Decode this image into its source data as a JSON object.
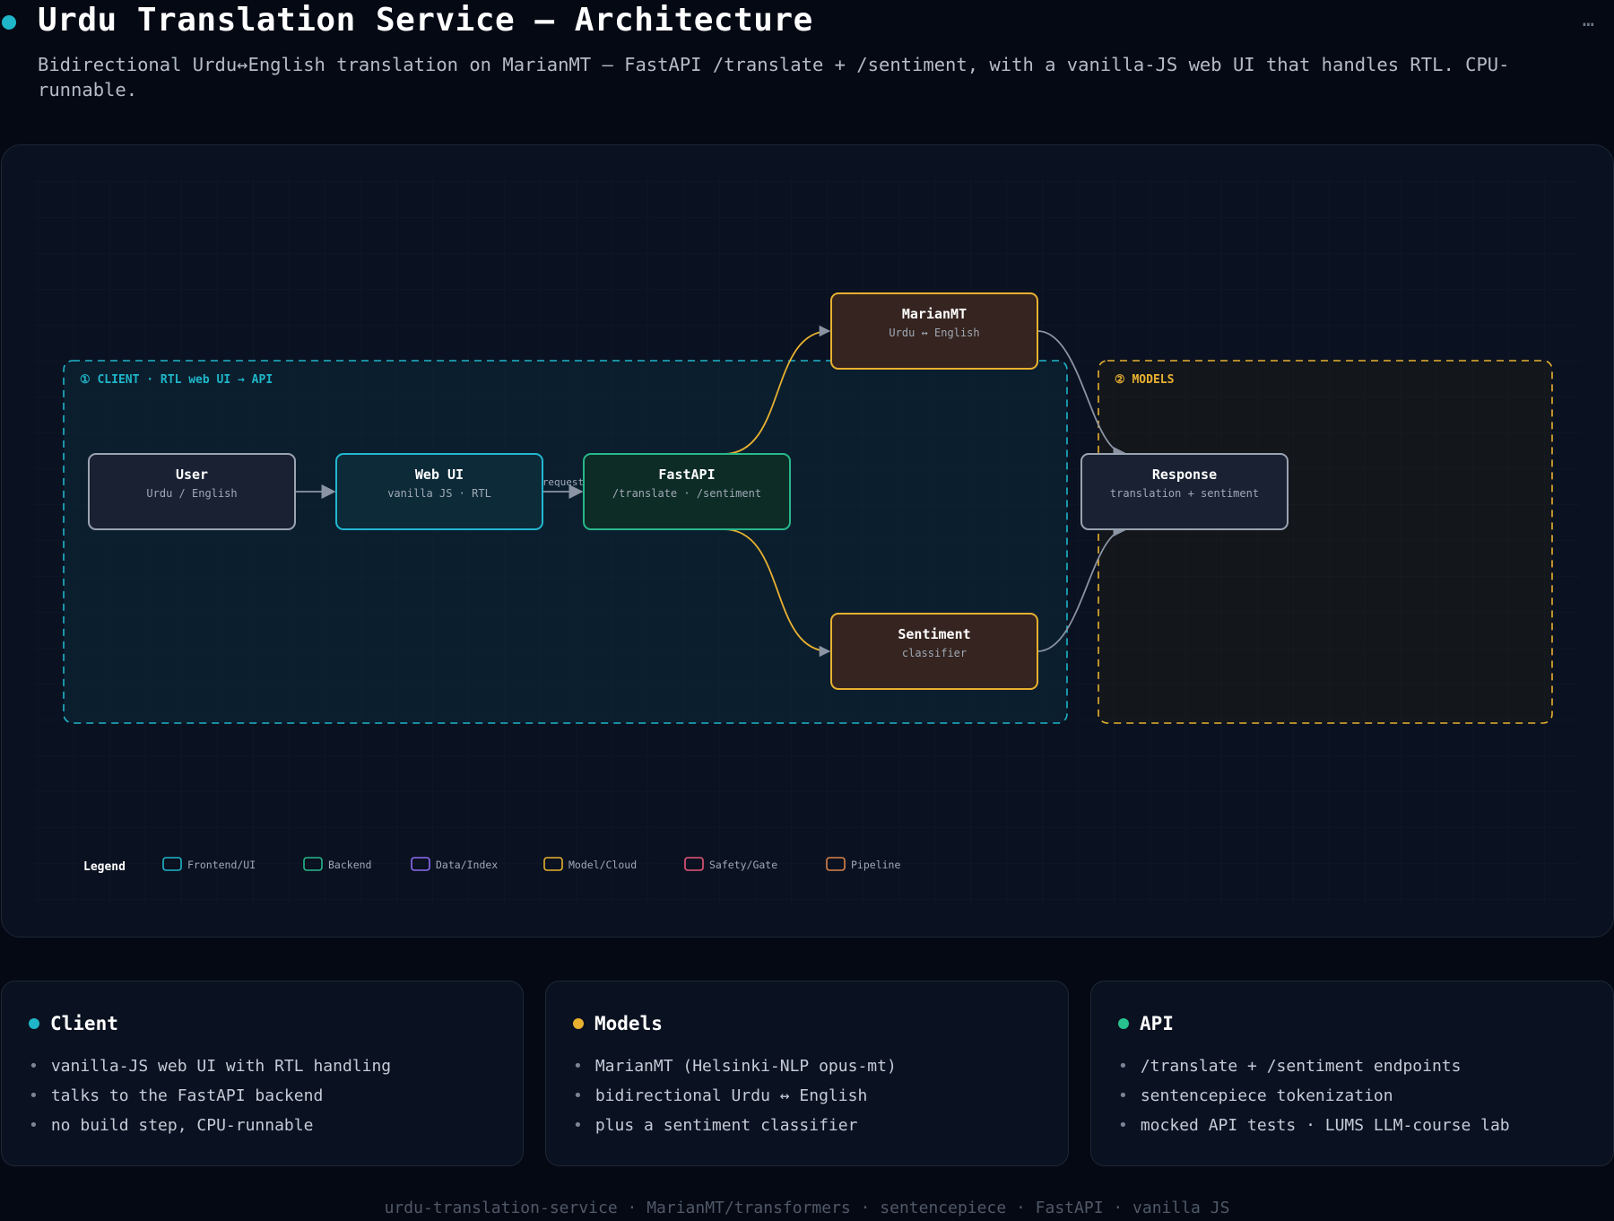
{
  "header": {
    "title": "Urdu Translation Service — Architecture",
    "subtitle": "Bidirectional Urdu↔English translation on MarianMT — FastAPI /translate + /sentiment, with a vanilla-JS web UI that handles RTL. CPU-runnable.",
    "more_icon": "…"
  },
  "diagram": {
    "groups": [
      {
        "id": "client",
        "label": "① CLIENT · RTL web UI → API",
        "color": "#1fb6c9"
      },
      {
        "id": "models",
        "label": "② MODELS",
        "color": "#e8b130"
      }
    ],
    "nodes": [
      {
        "id": "user",
        "title": "User",
        "subtitle": "Urdu / English",
        "kind": "neutral"
      },
      {
        "id": "webui",
        "title": "Web UI",
        "subtitle": "vanilla JS · RTL",
        "kind": "frontend"
      },
      {
        "id": "fastapi",
        "title": "FastAPI",
        "subtitle": "/translate · /sentiment",
        "kind": "backend"
      },
      {
        "id": "marianmt",
        "title": "MarianMT",
        "subtitle": "Urdu ↔ English",
        "kind": "model"
      },
      {
        "id": "sentiment",
        "title": "Sentiment",
        "subtitle": "classifier",
        "kind": "model"
      },
      {
        "id": "response",
        "title": "Response",
        "subtitle": "translation + sentiment",
        "kind": "neutral"
      }
    ],
    "edges": [
      {
        "from": "user",
        "to": "webui",
        "label": ""
      },
      {
        "from": "webui",
        "to": "fastapi",
        "label": "request"
      },
      {
        "from": "fastapi",
        "to": "marianmt",
        "label": ""
      },
      {
        "from": "fastapi",
        "to": "sentiment",
        "label": ""
      },
      {
        "from": "marianmt",
        "to": "response",
        "label": ""
      },
      {
        "from": "sentiment",
        "to": "response",
        "label": ""
      }
    ],
    "legend": {
      "title": "Legend",
      "items": [
        {
          "label": "Frontend/UI",
          "color": "#1fb6c9"
        },
        {
          "label": "Backend",
          "color": "#27b889"
        },
        {
          "label": "Data/Index",
          "color": "#8c6cf0"
        },
        {
          "label": "Model/Cloud",
          "color": "#e8b130"
        },
        {
          "label": "Safety/Gate",
          "color": "#e8577a"
        },
        {
          "label": "Pipeline",
          "color": "#d9834a"
        }
      ]
    }
  },
  "cards": [
    {
      "title": "Client",
      "color": "#1fb6c9",
      "items": [
        "vanilla-JS web UI with RTL handling",
        "talks to the FastAPI backend",
        "no build step, CPU-runnable"
      ]
    },
    {
      "title": "Models",
      "color": "#e8b130",
      "items": [
        "MarianMT (Helsinki-NLP opus-mt)",
        "bidirectional Urdu ↔ English",
        "plus a sentiment classifier"
      ]
    },
    {
      "title": "API",
      "color": "#27c28f",
      "items": [
        "/translate + /sentiment endpoints",
        "sentencepiece tokenization",
        "mocked API tests · LUMS LLM-course lab"
      ]
    }
  ],
  "footer": {
    "text": "urdu-translation-service · MarianMT/transformers · sentencepiece · FastAPI · vanilla JS"
  }
}
